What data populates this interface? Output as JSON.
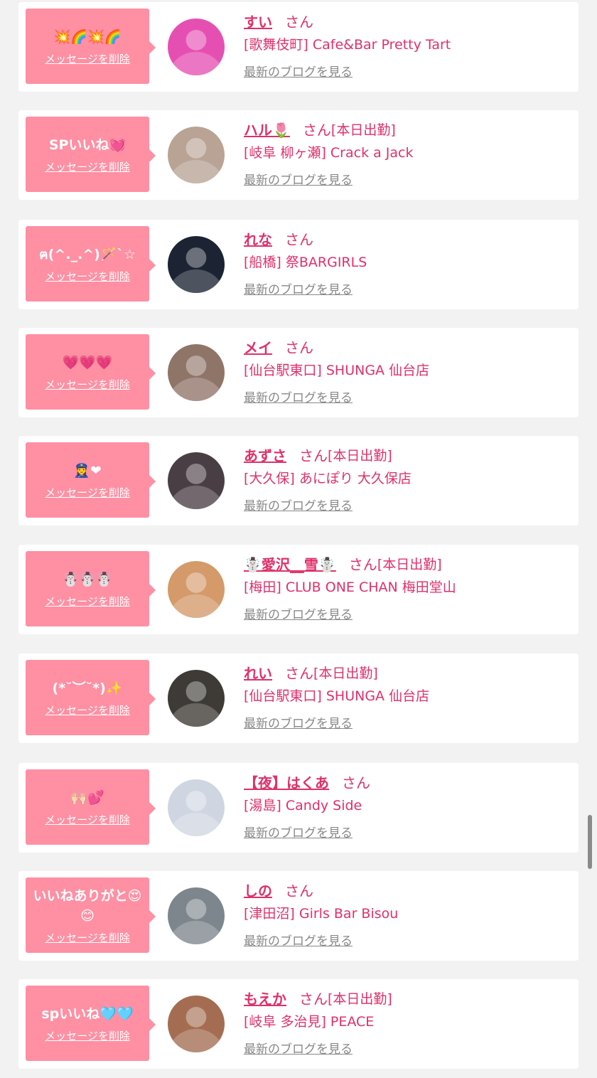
{
  "common": {
    "delete_label": "メッセージを削除",
    "san_label": "さん",
    "blog_label": "最新のブログを見る"
  },
  "colors": {
    "page_background": "#f2f2f2",
    "bubble": "#ff8fa3",
    "accent_text": "#e0306a",
    "link_gray": "#888888"
  },
  "items": [
    {
      "message": "💥🌈💥🌈",
      "name": "すい",
      "attendance": "",
      "shop": "[歌舞伎町] Cafe&Bar Pretty Tart",
      "avatar_color": "#e64fb2"
    },
    {
      "message": "SPいいね💓",
      "name": "ハル🌷",
      "attendance": "[本日出勤]",
      "shop": "[岐阜 柳ヶ瀬] Crack a Jack",
      "avatar_color": "#b9a395"
    },
    {
      "message": "ฅ(^._.^)🪄`☆",
      "name": "れな",
      "attendance": "",
      "shop": "[船橋] 祭BARGIRLS",
      "avatar_color": "#1c2333"
    },
    {
      "message": "💗💗💗",
      "name": "メイ",
      "attendance": "",
      "shop": "[仙台駅東口] SHUNGA 仙台店",
      "avatar_color": "#8f7468"
    },
    {
      "message": "👮‍♀️❤",
      "name": "あずさ",
      "attendance": "[本日出勤]",
      "shop": "[大久保] あにぽり 大久保店",
      "avatar_color": "#4a3e45"
    },
    {
      "message": "☃️☃️☃️",
      "name": "☃️愛沢__雪☃️",
      "attendance": "[本日出勤]",
      "shop": "[梅田] CLUB ONE CHAN 梅田堂山",
      "avatar_color": "#d49a6a"
    },
    {
      "message": "(*˘︶˘*)✨",
      "name": "れい",
      "attendance": "[本日出勤]",
      "shop": "[仙台駅東口] SHUNGA 仙台店",
      "avatar_color": "#3e3a35"
    },
    {
      "message": "🙌🏻💕",
      "name": "【夜】はくあ",
      "attendance": "",
      "shop": "[湯島] Candy Side",
      "avatar_color": "#cfd6e2"
    },
    {
      "message": "いいねありがと😍\n😊",
      "name": "しの",
      "attendance": "",
      "shop": "[津田沼] Girls Bar Bisou",
      "avatar_color": "#7d868c"
    },
    {
      "message": "spいいね🩵🩵",
      "name": "もえか",
      "attendance": "[本日出勤]",
      "shop": "[岐阜 多治見] PEACE",
      "avatar_color": "#a46d52"
    }
  ]
}
